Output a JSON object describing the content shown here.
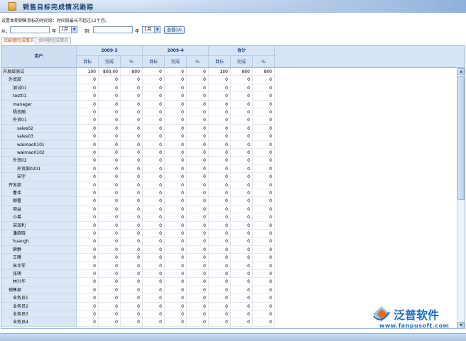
{
  "window": {
    "title": "销售目标完成情况跟踪"
  },
  "hint": "设置本期销售目标的时间段：时间段最长不超过12个月。",
  "filter": {
    "from_label": "从：",
    "to_label": "到：",
    "year_label": "年",
    "month_from": "1月",
    "month_to": "1月",
    "from_year_value": "",
    "to_year_value": "",
    "view_button": "查看(V)"
  },
  "tabs": [
    {
      "label": "回款额完成情况"
    },
    {
      "label": "合同额完成情况"
    }
  ],
  "grid": {
    "user_header": "用户",
    "groups": [
      {
        "label": "2009-3"
      },
      {
        "label": "2009-4"
      },
      {
        "label": "合计"
      }
    ],
    "subheaders": [
      "目标",
      "完成",
      "%",
      "目标",
      "完成",
      "%",
      "目标",
      "完成",
      "%"
    ],
    "rows": [
      {
        "name": "开发部测试",
        "vals": [
          "100",
          "800.00",
          "800",
          "0",
          "0",
          "0",
          "100",
          "800",
          "800"
        ]
      },
      {
        "name": "外贸部",
        "vals": [
          "0",
          "0",
          "0",
          "0",
          "0",
          "0",
          "0",
          "0",
          "0"
        ]
      },
      {
        "name": "测试01",
        "vals": [
          "0",
          "0",
          "0",
          "0",
          "0",
          "0",
          "0",
          "0",
          "0"
        ]
      },
      {
        "name": "test01",
        "vals": [
          "0",
          "0",
          "0",
          "0",
          "0",
          "0",
          "0",
          "0",
          "0"
        ]
      },
      {
        "name": "manager",
        "vals": [
          "0",
          "0",
          "0",
          "0",
          "0",
          "0",
          "0",
          "0",
          "0"
        ]
      },
      {
        "name": "杨志随",
        "vals": [
          "0",
          "0",
          "0",
          "0",
          "0",
          "0",
          "0",
          "0",
          "0"
        ]
      },
      {
        "name": "外贸01",
        "vals": [
          "0",
          "0",
          "0",
          "0",
          "0",
          "0",
          "0",
          "0",
          "0"
        ]
      },
      {
        "name": "sales02",
        "vals": [
          "0",
          "0",
          "0",
          "0",
          "0",
          "0",
          "0",
          "0",
          "0"
        ]
      },
      {
        "name": "sales03",
        "vals": [
          "0",
          "0",
          "0",
          "0",
          "0",
          "0",
          "0",
          "0",
          "0"
        ]
      },
      {
        "name": "waimao0101",
        "vals": [
          "0",
          "0",
          "0",
          "0",
          "0",
          "0",
          "0",
          "0",
          "0"
        ]
      },
      {
        "name": "waimao0102",
        "vals": [
          "0",
          "0",
          "0",
          "0",
          "0",
          "0",
          "0",
          "0",
          "0"
        ]
      },
      {
        "name": "外贸02",
        "vals": [
          "0",
          "0",
          "0",
          "0",
          "0",
          "0",
          "0",
          "0",
          "0"
        ]
      },
      {
        "name": "外贸部0201",
        "vals": [
          "0",
          "0",
          "0",
          "0",
          "0",
          "0",
          "0",
          "0",
          "0"
        ]
      },
      {
        "name": "宋宇",
        "vals": [
          "0",
          "0",
          "0",
          "0",
          "0",
          "0",
          "0",
          "0",
          "0"
        ]
      },
      {
        "name": "开发部",
        "vals": [
          "0",
          "0",
          "0",
          "0",
          "0",
          "0",
          "0",
          "0",
          "0"
        ]
      },
      {
        "name": "曹伟",
        "vals": [
          "0",
          "0",
          "0",
          "0",
          "0",
          "0",
          "0",
          "0",
          "0"
        ]
      },
      {
        "name": "郦蕾",
        "vals": [
          "0",
          "0",
          "0",
          "0",
          "0",
          "0",
          "0",
          "0",
          "0"
        ]
      },
      {
        "name": "项益",
        "vals": [
          "0",
          "0",
          "0",
          "0",
          "0",
          "0",
          "0",
          "0",
          "0"
        ]
      },
      {
        "name": "小葛",
        "vals": [
          "0",
          "0",
          "0",
          "0",
          "0",
          "0",
          "0",
          "0",
          "0"
        ]
      },
      {
        "name": "宋效利",
        "vals": [
          "0",
          "0",
          "0",
          "0",
          "0",
          "0",
          "0",
          "0",
          "0"
        ]
      },
      {
        "name": "潘欲晓",
        "vals": [
          "0",
          "0",
          "0",
          "0",
          "0",
          "0",
          "0",
          "0",
          "0"
        ]
      },
      {
        "name": "huangh",
        "vals": [
          "0",
          "0",
          "0",
          "0",
          "0",
          "0",
          "0",
          "0",
          "0"
        ]
      },
      {
        "name": "薛静",
        "vals": [
          "0",
          "0",
          "0",
          "0",
          "0",
          "0",
          "0",
          "0",
          "0"
        ]
      },
      {
        "name": "王曦",
        "vals": [
          "0",
          "0",
          "0",
          "0",
          "0",
          "0",
          "0",
          "0",
          "0"
        ]
      },
      {
        "name": "朱华军",
        "vals": [
          "0",
          "0",
          "0",
          "0",
          "0",
          "0",
          "0",
          "0",
          "0"
        ]
      },
      {
        "name": "张萌",
        "vals": [
          "0",
          "0",
          "0",
          "0",
          "0",
          "0",
          "0",
          "0",
          "0"
        ]
      },
      {
        "name": "林兴华",
        "vals": [
          "0",
          "0",
          "0",
          "0",
          "0",
          "0",
          "0",
          "0",
          "0"
        ]
      },
      {
        "name": "销售部",
        "vals": [
          "0",
          "0",
          "0",
          "0",
          "0",
          "0",
          "0",
          "0",
          "0"
        ]
      },
      {
        "name": "业务员1",
        "vals": [
          "0",
          "0",
          "0",
          "0",
          "0",
          "0",
          "0",
          "0",
          "0"
        ]
      },
      {
        "name": "业务员2",
        "vals": [
          "0",
          "0",
          "0",
          "0",
          "0",
          "0",
          "0",
          "0",
          "0"
        ]
      },
      {
        "name": "业务员3",
        "vals": [
          "0",
          "0",
          "0",
          "0",
          "0",
          "0",
          "0",
          "0",
          "0"
        ]
      },
      {
        "name": "业务员4",
        "vals": [
          "0",
          "0",
          "0",
          "0",
          "0",
          "0",
          "0",
          "0",
          "0"
        ]
      }
    ]
  },
  "logo": {
    "brand": "泛普软件",
    "url": "www.fanpusoft.com"
  },
  "colors": {
    "header_bg": "#d7e4f5",
    "name_col_bg": "#dbe7f6",
    "brand_blue": "#1d6cc4",
    "active_tab": "#c04a00"
  }
}
